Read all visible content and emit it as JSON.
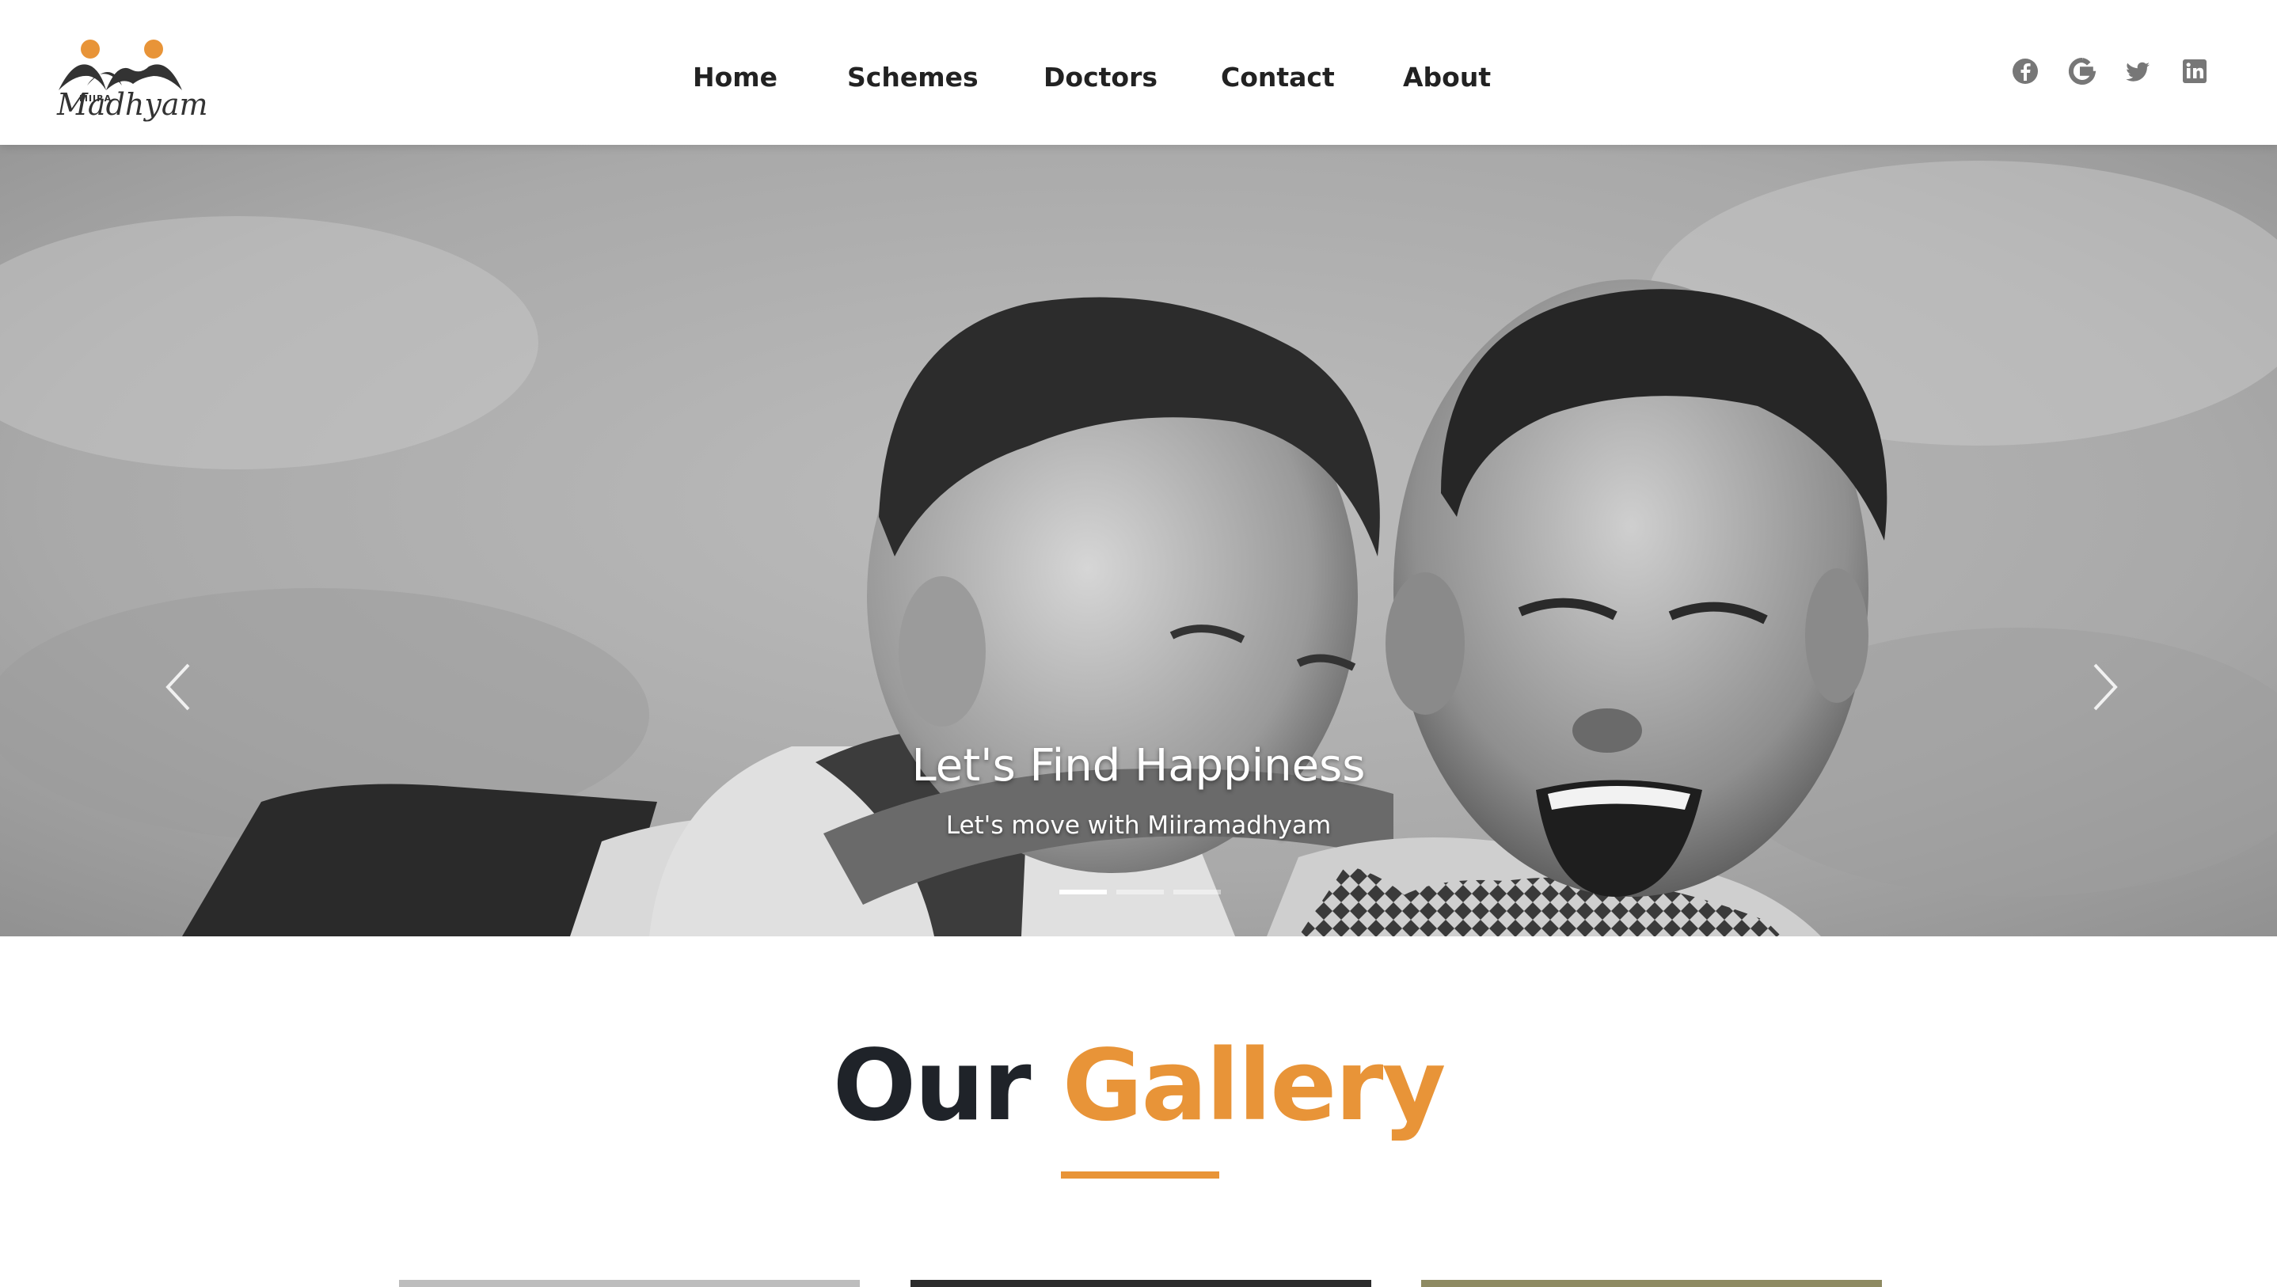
{
  "brand": {
    "small": "MIIRA",
    "main": "Madhyam"
  },
  "nav": {
    "items": [
      {
        "label": "Home"
      },
      {
        "label": "Schemes"
      },
      {
        "label": "Doctors"
      },
      {
        "label": "Contact"
      },
      {
        "label": "About"
      }
    ]
  },
  "social": [
    "facebook-icon",
    "google-icon",
    "twitter-icon",
    "linkedin-icon"
  ],
  "hero": {
    "title": "Let's Find Happiness",
    "subtitle": "Let's move with Miiramadhyam",
    "slides_count": 3,
    "active_slide": 1
  },
  "gallery": {
    "heading_dark": "Our",
    "heading_accent": "Gallery"
  },
  "colors": {
    "accent": "#e89438",
    "dark": "#1f2329",
    "nav_text": "#222222",
    "social": "#777777"
  }
}
